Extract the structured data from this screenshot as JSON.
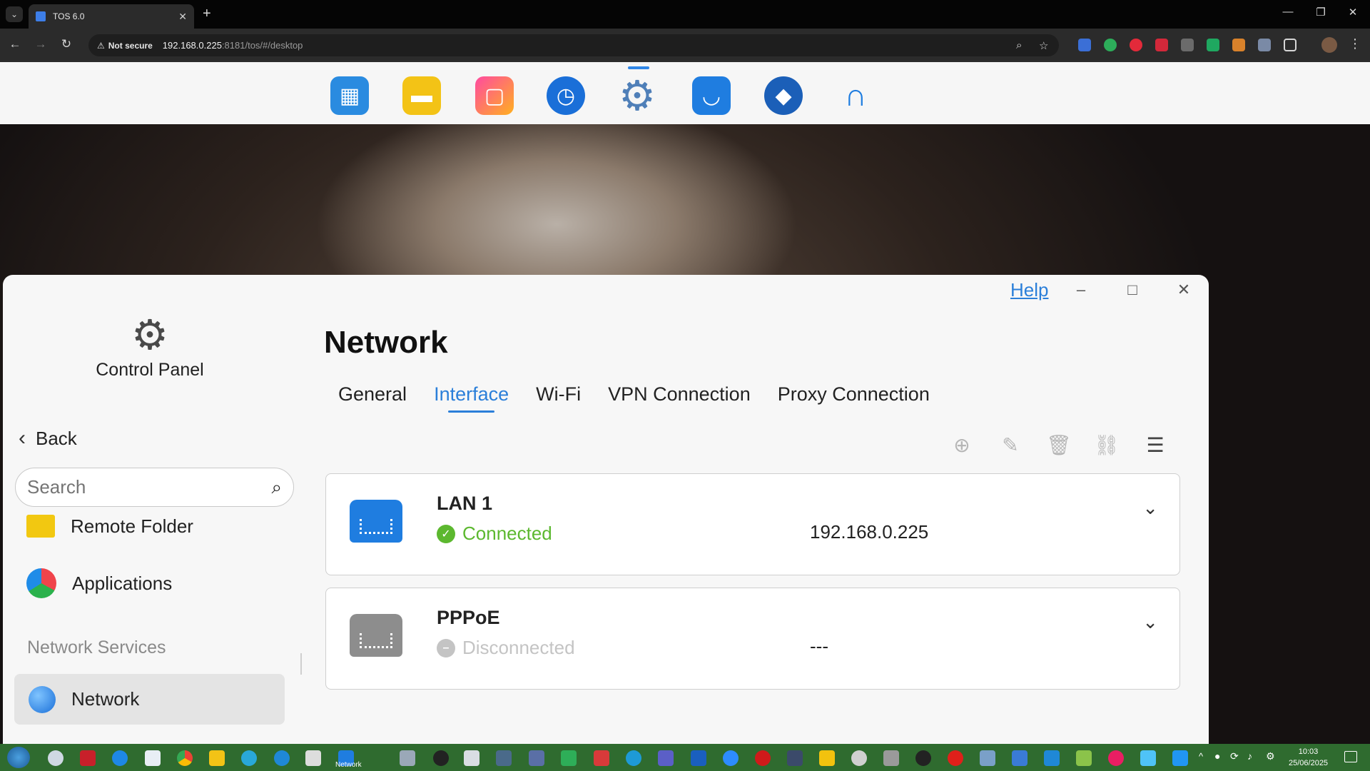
{
  "browser": {
    "tab_title": "TOS 6.0",
    "security_label": "Not secure",
    "url_host": "192.168.0.225",
    "url_path": ":8181/tos/#/desktop",
    "new_tab_icon": "plus-icon"
  },
  "dock": {
    "apps": [
      "tos-apps-icon",
      "file-manager-icon",
      "picture-icon",
      "backup-clock-icon",
      "control-panel-gear-icon",
      "app-center-bag-icon",
      "docker-icon",
      "support-headset-icon"
    ],
    "active_app": "control-panel-gear-icon"
  },
  "window": {
    "help_label": "Help",
    "sidebar": {
      "title": "Control Panel",
      "back_label": "Back",
      "search_placeholder": "Search",
      "items": [
        {
          "label": "Remote Folder",
          "icon": "remote-folder-icon"
        },
        {
          "label": "Applications",
          "icon": "applications-icon"
        }
      ],
      "section_label": "Network Services",
      "active_item": {
        "label": "Network",
        "icon": "network-globe-icon"
      }
    },
    "main": {
      "title": "Network",
      "tabs": [
        {
          "label": "General",
          "active": false
        },
        {
          "label": "Interface",
          "active": true
        },
        {
          "label": "Wi-Fi",
          "active": false
        },
        {
          "label": "VPN Connection",
          "active": false
        },
        {
          "label": "Proxy Connection",
          "active": false
        }
      ],
      "toolbar": [
        "add-icon",
        "edit-icon",
        "delete-icon",
        "link-icon",
        "sort-icon"
      ],
      "interfaces": [
        {
          "name": "LAN 1",
          "status": "Connected",
          "ip": "192.168.0.225",
          "icon_color": "#1f7de0",
          "status_color": "#5cb82f"
        },
        {
          "name": "PPPoE",
          "status": "Disconnected",
          "ip": "---",
          "icon_color": "#8d8d8d",
          "status_color": "#c4c4c4"
        }
      ]
    }
  },
  "taskbar": {
    "time": "10:03",
    "date": "25/06/2025",
    "active_label": "Network"
  },
  "colors": {
    "accent": "#2b7fd9",
    "connected": "#5cb82f",
    "disconnected": "#c4c4c4"
  }
}
